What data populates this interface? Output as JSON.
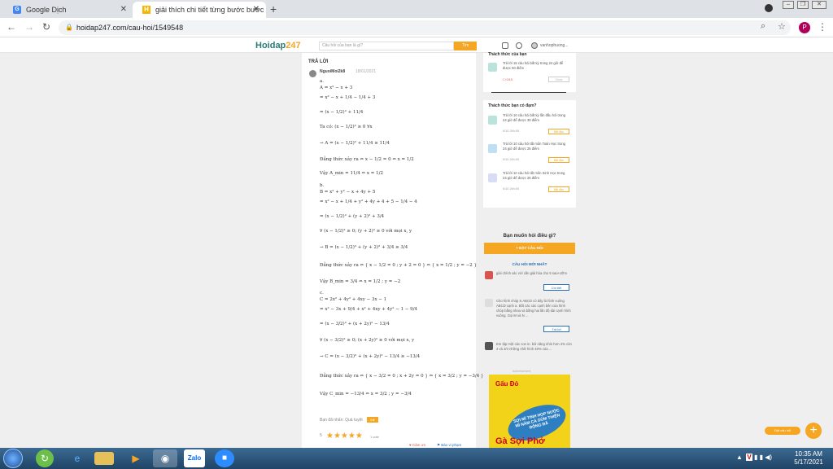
{
  "browser": {
    "tabs": [
      {
        "label": "Google Dịch",
        "favicon": "G"
      },
      {
        "label": "giải thích chi tiết từng bước bước",
        "favicon": "H"
      }
    ],
    "url": "hoidap247.com/cau-hoi/1549548",
    "profile_initial": "P"
  },
  "site": {
    "logo_main": "Hoidap",
    "logo_num": "247",
    "search_placeholder": "Câu hỏi của bạn là gì?",
    "search_button": "Tìm",
    "username": "vanhophuong..."
  },
  "answer": {
    "heading": "TRẢ LỜI",
    "author": "NguoiMoi2k8",
    "date": "18/01/2021",
    "math_lines": [
      "a.",
      "A = x² − x + 3",
      "= x² − x + 1/4 − 1/4 + 3",
      "= (x − 1/2)² + 11/4",
      "Ta có: (x − 1/2)² ≥ 0 ∀x",
      "→ A = (x − 1/2)² + 11/4 ≥ 11/4",
      "Đẳng thức xảy ra ⇔ x − 1/2 = 0 ⇔ x = 1/2",
      "Vậy A_min = 11/4 ⇔ x = 1/2",
      "b.",
      "B = x² + y² − x + 4y + 5",
      "= x² − x + 1/4 + y² + 4y + 4 + 5 − 1/4 − 4",
      "= (x − 1/2)² + (y + 2)² + 3/4",
      "∀ (x − 1/2)² ≥ 0; (y + 2)² ≥ 0 với mọi x, y",
      "→ B = (x − 1/2)² + (y + 2)² + 3/4 ≥ 3/4",
      "Đẳng thức xảy ra ⇔ { x − 1/2 = 0 ; y + 2 = 0 } ⇔ { x = 1/2 ; y = −2 }",
      "Vậy B_min = 3/4 ⇔ x = 1/2 ; y = −2",
      "c.",
      "C = 2x² + 4y² + 4xy − 3x − 1",
      "= x² − 3x + 9/4 + x² + 4xy + 4y² − 1 − 9/4",
      "= (x − 3/2)² + (x + 2y)² − 13/4",
      "∀ (x − 3/2)² ≥ 0; (x + 2y)² ≥ 0 với mọi x, y",
      "→ C = (x − 3/2)² + (x + 2y)² − 13/4 ≥ −13/4",
      "Đẳng thức xảy ra ⇔ { x − 3/2 = 0 ; x + 2y = 0 } ⇔ { x = 3/2 ; y = −3/4 }",
      "Vậy C_min = −13/4 ⇔ x = 3/2 ; y = −3/4"
    ],
    "tags_label": "Bạn đã nhấn: Quá tuyệt",
    "badge": "5★",
    "rating_count": "5",
    "stars": "★★★★★",
    "votes": "1 vote",
    "thanks": "♥ Cảm ơn",
    "report": "⚑ Báo vi phạm"
  },
  "sidebar": {
    "challenge_title_top": "Thách thức của bạn",
    "challenge_top": {
      "text": "Trả lời 15 câu hỏi bất kỳ trong 24 giờ để được 50 điểm",
      "meta": "☐ 0/15",
      "button": "Chưa"
    },
    "challenge_title": "Thách thức bạn có đạm?",
    "challenges": [
      {
        "text": "Trả lời 10 câu hỏi bất kỳ lần đầu hỏi trong 24 giờ để được 30 điểm",
        "meta": "0/10  24h:00",
        "button": "Bắt đầu"
      },
      {
        "text": "Trả lời 10 câu hỏi tất môn Toán Học trong 24 giờ để được 25 điểm",
        "meta": "0/10  24h:00",
        "button": "Bắt đầu"
      },
      {
        "text": "Trả lời 10 câu hỏi tất môn Sinh Học trong 24 giờ để được 25 điểm",
        "meta": "0/10  24h:00",
        "button": "Bắt đầu"
      }
    ],
    "ask_heading": "Bạn muốn hỏi điều gì?",
    "ask_button": "+ ĐẶT CÂU HỎI",
    "new_questions_title": "CÂU HỎI MỚI NHẤT",
    "questions": [
      {
        "text": "giải chính xác với cần giải hóa cho 5 sao+ctlhn",
        "button": "Chi tiết"
      },
      {
        "text": "Cho hình chóp S.ABCD có đáy là hình vuông ABCD cạnh a. Bốt các các cạnh bên của hình chóp bằng nhau và bằng hai lần độ dài cạnh hình vuông. Gọi M và N ...",
        "button": "Trả lời"
      },
      {
        "text": "Em tập một các con in. bỏi năng nhìn hơn 4% còn 4 và 3/4 những nhữ hình 40% của ...",
        "button": ""
      }
    ],
    "ad_label": "Advertisement",
    "ad_brand": "Gấu Đỏ",
    "ad_slogan": "SỢI MÌ TINH HỌP NƯỚC MÌ NĂM CÀ DÙM THIỆN ĐỘNG ĐÃ",
    "ad_product": "Gà Sợi Phở"
  },
  "floating": {
    "label": "Đặt câu hỏi",
    "icon": "+"
  },
  "taskbar": {
    "time": "10:35 AM",
    "date": "5/17/2021",
    "zalo": "Zalo"
  }
}
